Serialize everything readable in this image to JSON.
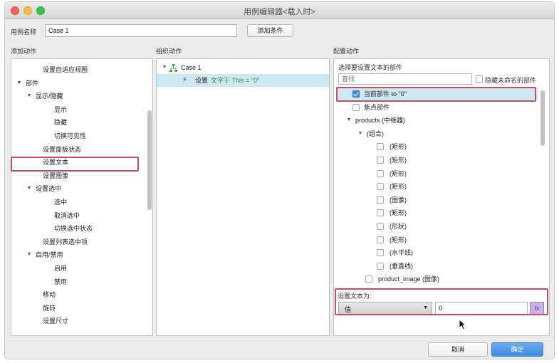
{
  "window": {
    "title": "用例编辑器<载入时>"
  },
  "case_name": {
    "label": "用例名称",
    "value": "Case 1",
    "add_condition": "添加条件"
  },
  "columns": {
    "left": "添加动作",
    "middle": "组织动作",
    "right": "配置动作"
  },
  "left_tree": [
    {
      "text": "设置自适应视图",
      "indent": 2,
      "arrow": false
    },
    {
      "text": "部件",
      "indent": 0,
      "arrow": true
    },
    {
      "text": "显示/隐藏",
      "indent": 1,
      "arrow": true
    },
    {
      "text": "显示",
      "indent": 3,
      "arrow": false
    },
    {
      "text": "隐藏",
      "indent": 3,
      "arrow": false
    },
    {
      "text": "切换可见性",
      "indent": 3,
      "arrow": false
    },
    {
      "text": "设置面板状态",
      "indent": 2,
      "arrow": false
    },
    {
      "text": "设置文本",
      "indent": 2,
      "arrow": false
    },
    {
      "text": "设置图像",
      "indent": 2,
      "arrow": false
    },
    {
      "text": "设置选中",
      "indent": 1,
      "arrow": true
    },
    {
      "text": "选中",
      "indent": 3,
      "arrow": false
    },
    {
      "text": "取消选中",
      "indent": 3,
      "arrow": false
    },
    {
      "text": "切换选中状态",
      "indent": 3,
      "arrow": false
    },
    {
      "text": "设置列表选中项",
      "indent": 2,
      "arrow": false
    },
    {
      "text": "启用/禁用",
      "indent": 1,
      "arrow": true
    },
    {
      "text": "启用",
      "indent": 3,
      "arrow": false
    },
    {
      "text": "禁用",
      "indent": 3,
      "arrow": false
    },
    {
      "text": "移动",
      "indent": 2,
      "arrow": false
    },
    {
      "text": "旋转",
      "indent": 2,
      "arrow": false
    },
    {
      "text": "设置尺寸",
      "indent": 2,
      "arrow": false
    }
  ],
  "organize": {
    "case": "Case 1",
    "action_verb": "设置",
    "action_detail": "文字于 This = \"0\""
  },
  "configure": {
    "prompt": "选择要设置文本的部件",
    "search_placeholder": "查找",
    "hide_unnamed": "隐藏未命名的部件",
    "widgets": [
      {
        "text": "当前部件 to \"0\"",
        "type": "check",
        "checked": true,
        "indent": 0
      },
      {
        "text": "焦点部件",
        "type": "check",
        "checked": false,
        "indent": 0
      },
      {
        "text": "products (中继器)",
        "type": "group",
        "indent": 0
      },
      {
        "text": "(组合)",
        "type": "group",
        "indent": 1
      },
      {
        "text": "(矩形)",
        "type": "check",
        "checked": false,
        "indent": 2
      },
      {
        "text": "(矩形)",
        "type": "check",
        "checked": false,
        "indent": 2
      },
      {
        "text": "(矩形)",
        "type": "check",
        "checked": false,
        "indent": 2
      },
      {
        "text": "(矩形)",
        "type": "check",
        "checked": false,
        "indent": 2
      },
      {
        "text": "(图像)",
        "type": "check",
        "checked": false,
        "indent": 2
      },
      {
        "text": "(矩形)",
        "type": "check",
        "checked": false,
        "indent": 2
      },
      {
        "text": "(形状)",
        "type": "check",
        "checked": false,
        "indent": 2
      },
      {
        "text": "(矩形)",
        "type": "check",
        "checked": false,
        "indent": 2
      },
      {
        "text": "(水平线)",
        "type": "check",
        "checked": false,
        "indent": 2
      },
      {
        "text": "(垂直线)",
        "type": "check",
        "checked": false,
        "indent": 2
      },
      {
        "text": "product_image (图像)",
        "type": "check",
        "checked": false,
        "indent": 1
      }
    ],
    "set_text_label": "设置文本为:",
    "type_select": "值",
    "value": "0",
    "fx": "fx"
  },
  "footer": {
    "cancel": "取消",
    "ok": "确定"
  },
  "colors": {
    "highlight_red": "#c0505b",
    "selected_row": "#cde8f2",
    "accent_blue": "#3d8ae3"
  }
}
